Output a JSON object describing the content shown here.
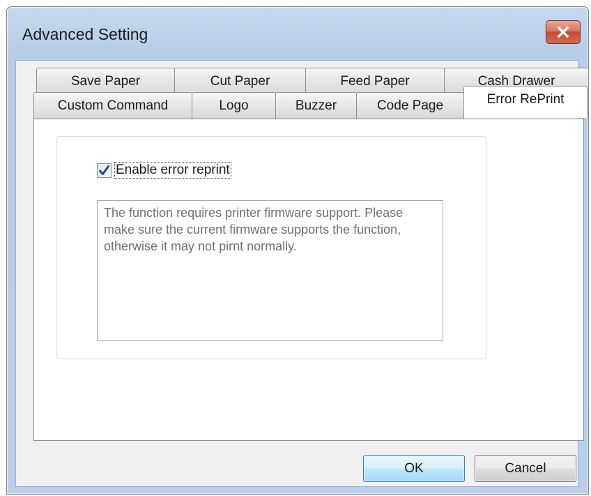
{
  "window": {
    "title": "Advanced Setting",
    "close_icon": "close-icon"
  },
  "tabs": {
    "back_row": [
      {
        "label": "Save Paper"
      },
      {
        "label": "Cut Paper"
      },
      {
        "label": "Feed Paper"
      },
      {
        "label": "Cash Drawer"
      }
    ],
    "front_row": [
      {
        "label": "Custom Command"
      },
      {
        "label": "Logo"
      },
      {
        "label": "Buzzer"
      },
      {
        "label": "Code Page"
      },
      {
        "label": "Error RePrint"
      }
    ],
    "selected": "Error RePrint"
  },
  "panel": {
    "checkbox": {
      "label": "Enable error reprint",
      "checked": true,
      "icon": "checkmark-icon"
    },
    "note": "The function requires printer firmware support. Please make sure the current firmware supports the function, otherwise it may not pirnt normally."
  },
  "buttons": {
    "ok_label": "OK",
    "cancel_label": "Cancel"
  },
  "colors": {
    "close_button": "#c44a33",
    "checkmark": "#1f4a8a",
    "window_frame": "#b9cfe9"
  }
}
